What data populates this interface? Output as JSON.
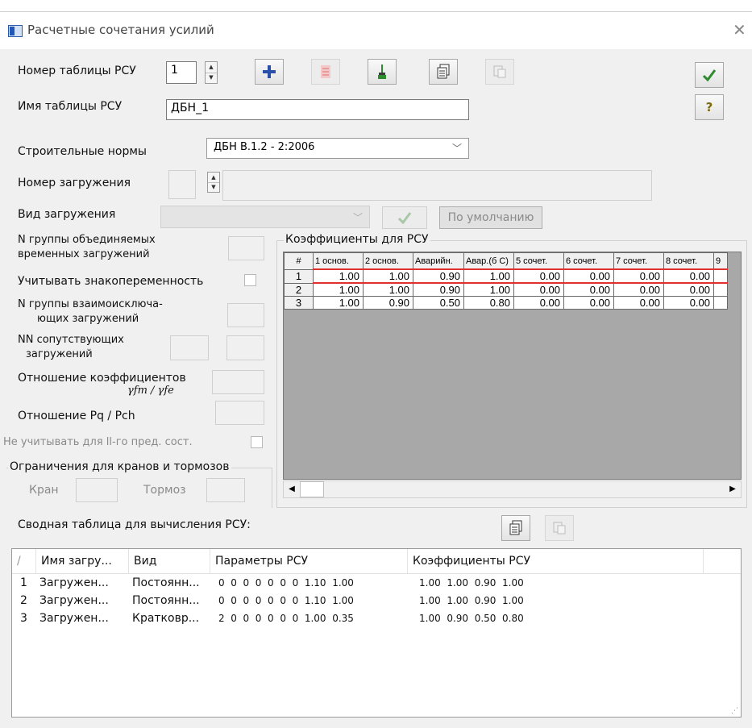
{
  "window": {
    "title": "Расчетные сочетания усилий"
  },
  "form": {
    "table_number_label": "Номер таблицы РСУ",
    "table_number_value": "1",
    "table_name_label": "Имя таблицы РСУ",
    "table_name_value": "ДБН_1",
    "norms_label": "Строительные нормы",
    "norms_value": "ДБН В.1.2 - 2:2006",
    "loadcase_number_label": "Номер загружения",
    "loadcase_type_label": "Вид загружения",
    "default_button": "По умолчанию",
    "group_combined_label_1": "N группы объединяемых",
    "group_combined_label_2": "временных загружений",
    "sign_variable_label": "Учитывать знакопеременность",
    "group_exclusive_label_1": "N группы взаимоисключа-",
    "group_exclusive_label_2": "ющих загружений",
    "accompanying_label_1": "NN сопутствующих",
    "accompanying_label_2": "загружений",
    "coef_ratio_label": "Отношение коэффициентов",
    "coef_ratio_symbol": "γfm / γfe",
    "pq_ratio_label": "Отношение  Pq / Pch",
    "ignore_second_label": "Не учитывать для ll-го пред. сост.",
    "crane_group_label": "Ограничения для кранов и тормозов",
    "crane_label": "Кран",
    "brake_label": "Тормоз"
  },
  "coefficients": {
    "group_label": "Коэффициенты для РСУ",
    "headers": [
      "#",
      "1 основ.",
      "2 основ.",
      "Аварийн.",
      "Авар.(б С)",
      "5 сочет.",
      "6 сочет.",
      "7 сочет.",
      "8 сочет.",
      "9"
    ],
    "rows": [
      [
        "1",
        "1.00",
        "1.00",
        "0.90",
        "1.00",
        "0.00",
        "0.00",
        "0.00",
        "0.00"
      ],
      [
        "2",
        "1.00",
        "1.00",
        "0.90",
        "1.00",
        "0.00",
        "0.00",
        "0.00",
        "0.00"
      ],
      [
        "3",
        "1.00",
        "0.90",
        "0.50",
        "0.80",
        "0.00",
        "0.00",
        "0.00",
        "0.00"
      ]
    ]
  },
  "summary": {
    "label": "Сводная таблица для вычисления РСУ:",
    "headers": [
      "/",
      "Имя загру...",
      "Вид",
      "Параметры РСУ",
      "Коэффициенты РСУ"
    ],
    "rows": [
      [
        "1",
        "Загружен...",
        "Постоянн...",
        "0  0  0  0  0  0  0  1.10  1.00",
        "1.00  1.00  0.90  1.00"
      ],
      [
        "2",
        "Загружен...",
        "Постоянн...",
        "0  0  0  0  0  0  0  1.10  1.00",
        "1.00  1.00  0.90  1.00"
      ],
      [
        "3",
        "Загружен...",
        "Кратковр...",
        "2  0  0  0  0  0  0  1.00  0.35",
        "1.00  0.90  0.50  0.80"
      ]
    ]
  },
  "icons": {
    "add": "plus-icon",
    "delete": "delete-icon",
    "brush": "brush-icon",
    "copy": "copy-icon",
    "paste": "paste-icon",
    "ok": "check-icon",
    "help": "help-icon",
    "close": "close-icon"
  },
  "colors": {
    "accent_red": "#e03030",
    "add_blue": "#2a4fa8",
    "ok_green": "#2e8b2e",
    "help_olive": "#7a6a10"
  }
}
